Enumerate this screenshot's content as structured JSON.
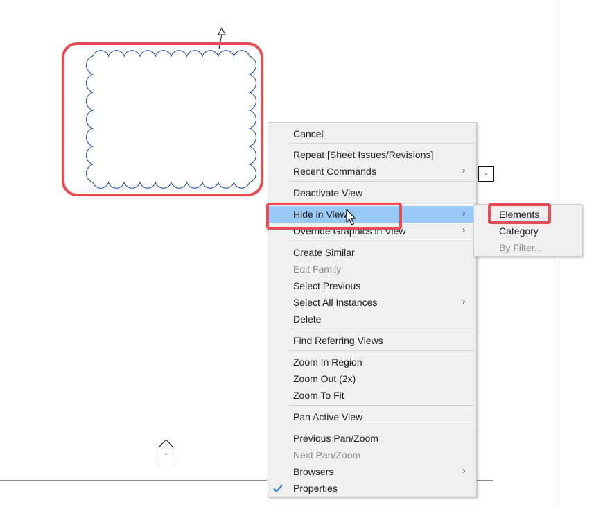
{
  "menu": {
    "items": [
      {
        "label": "Cancel",
        "state": "normal",
        "submenu": false
      },
      {
        "label": "Repeat [Sheet Issues/Revisions]",
        "state": "normal",
        "submenu": false
      },
      {
        "label": "Recent Commands",
        "state": "normal",
        "submenu": true
      },
      {
        "label": "Deactivate View",
        "state": "normal",
        "submenu": false
      },
      {
        "label": "Hide in View",
        "state": "highlighted",
        "submenu": true
      },
      {
        "label": "Override Graphics in View",
        "state": "normal",
        "submenu": true
      },
      {
        "label": "Create Similar",
        "state": "normal",
        "submenu": false
      },
      {
        "label": "Edit Family",
        "state": "disabled",
        "submenu": false
      },
      {
        "label": "Select Previous",
        "state": "normal",
        "submenu": false
      },
      {
        "label": "Select All Instances",
        "state": "normal",
        "submenu": true
      },
      {
        "label": "Delete",
        "state": "normal",
        "submenu": false
      },
      {
        "label": "Find Referring Views",
        "state": "normal",
        "submenu": false
      },
      {
        "label": "Zoom In Region",
        "state": "normal",
        "submenu": false
      },
      {
        "label": "Zoom Out (2x)",
        "state": "normal",
        "submenu": false
      },
      {
        "label": "Zoom To Fit",
        "state": "normal",
        "submenu": false
      },
      {
        "label": "Pan Active View",
        "state": "normal",
        "submenu": false
      },
      {
        "label": "Previous Pan/Zoom",
        "state": "normal",
        "submenu": false
      },
      {
        "label": "Next Pan/Zoom",
        "state": "disabled",
        "submenu": false
      },
      {
        "label": "Browsers",
        "state": "normal",
        "submenu": true
      },
      {
        "label": "Properties",
        "state": "checked",
        "submenu": false
      }
    ],
    "submenu_arrow": "›"
  },
  "submenu": {
    "items": [
      {
        "label": "Elements",
        "state": "normal"
      },
      {
        "label": "Category",
        "state": "normal"
      },
      {
        "label": "By Filter...",
        "state": "disabled"
      }
    ]
  },
  "colors": {
    "highlight": "#99c9f5",
    "callout": "#e84b53",
    "revision_cloud": "#1f4fa0",
    "check": "#1e6fd6"
  },
  "icons": {
    "check": "checkmark-icon",
    "cursor": "mouse-pointer-icon",
    "tag": "revision-tag-icon",
    "section_head": "view-reference-icon"
  }
}
